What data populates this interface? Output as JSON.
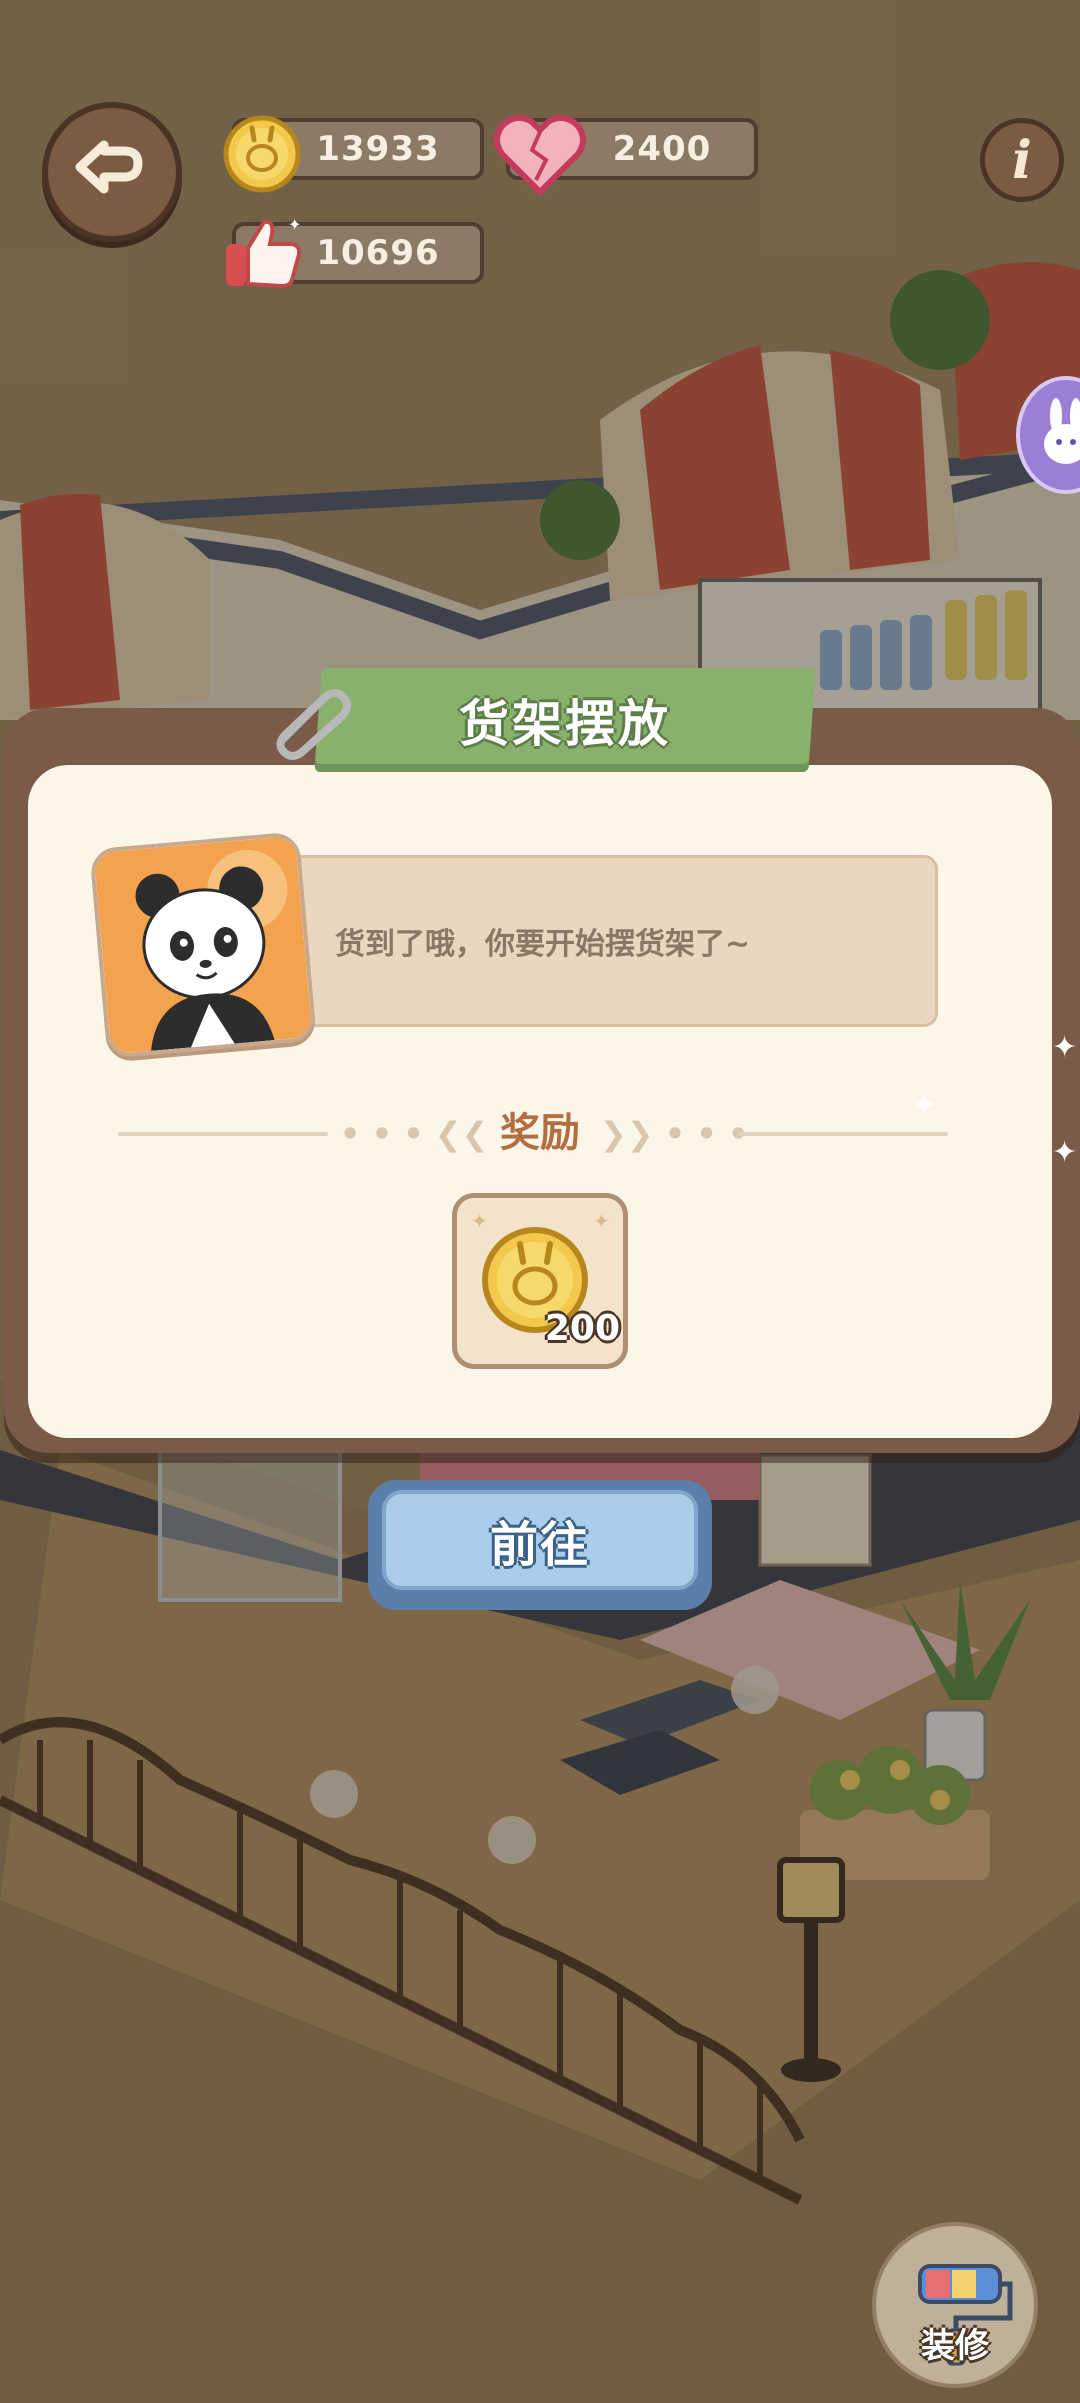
{
  "hud": {
    "coins": "13933",
    "hearts": "2400",
    "likes": "10696"
  },
  "dialog": {
    "title": "货架摆放",
    "message": "货到了哦，你要开始摆货架了~",
    "reward_label": "奖励",
    "reward_amount": "200",
    "go_button": "前往"
  },
  "bottom": {
    "decorate_label": "装修"
  },
  "icons": {
    "back": "back-arrow-icon",
    "info": "info-icon",
    "coin": "bunny-coin-icon",
    "heart": "heart-icon",
    "likes": "thumbs-up-icon",
    "rabbit": "rabbit-icon",
    "decorate": "paint-roller-icon"
  },
  "colors": {
    "dialog_frame": "#7a5a48",
    "dialog_body": "#fbf6e8",
    "title_tab": "#89b06c",
    "reward_label": "#b46e44",
    "go_button": "#a9cdea"
  }
}
